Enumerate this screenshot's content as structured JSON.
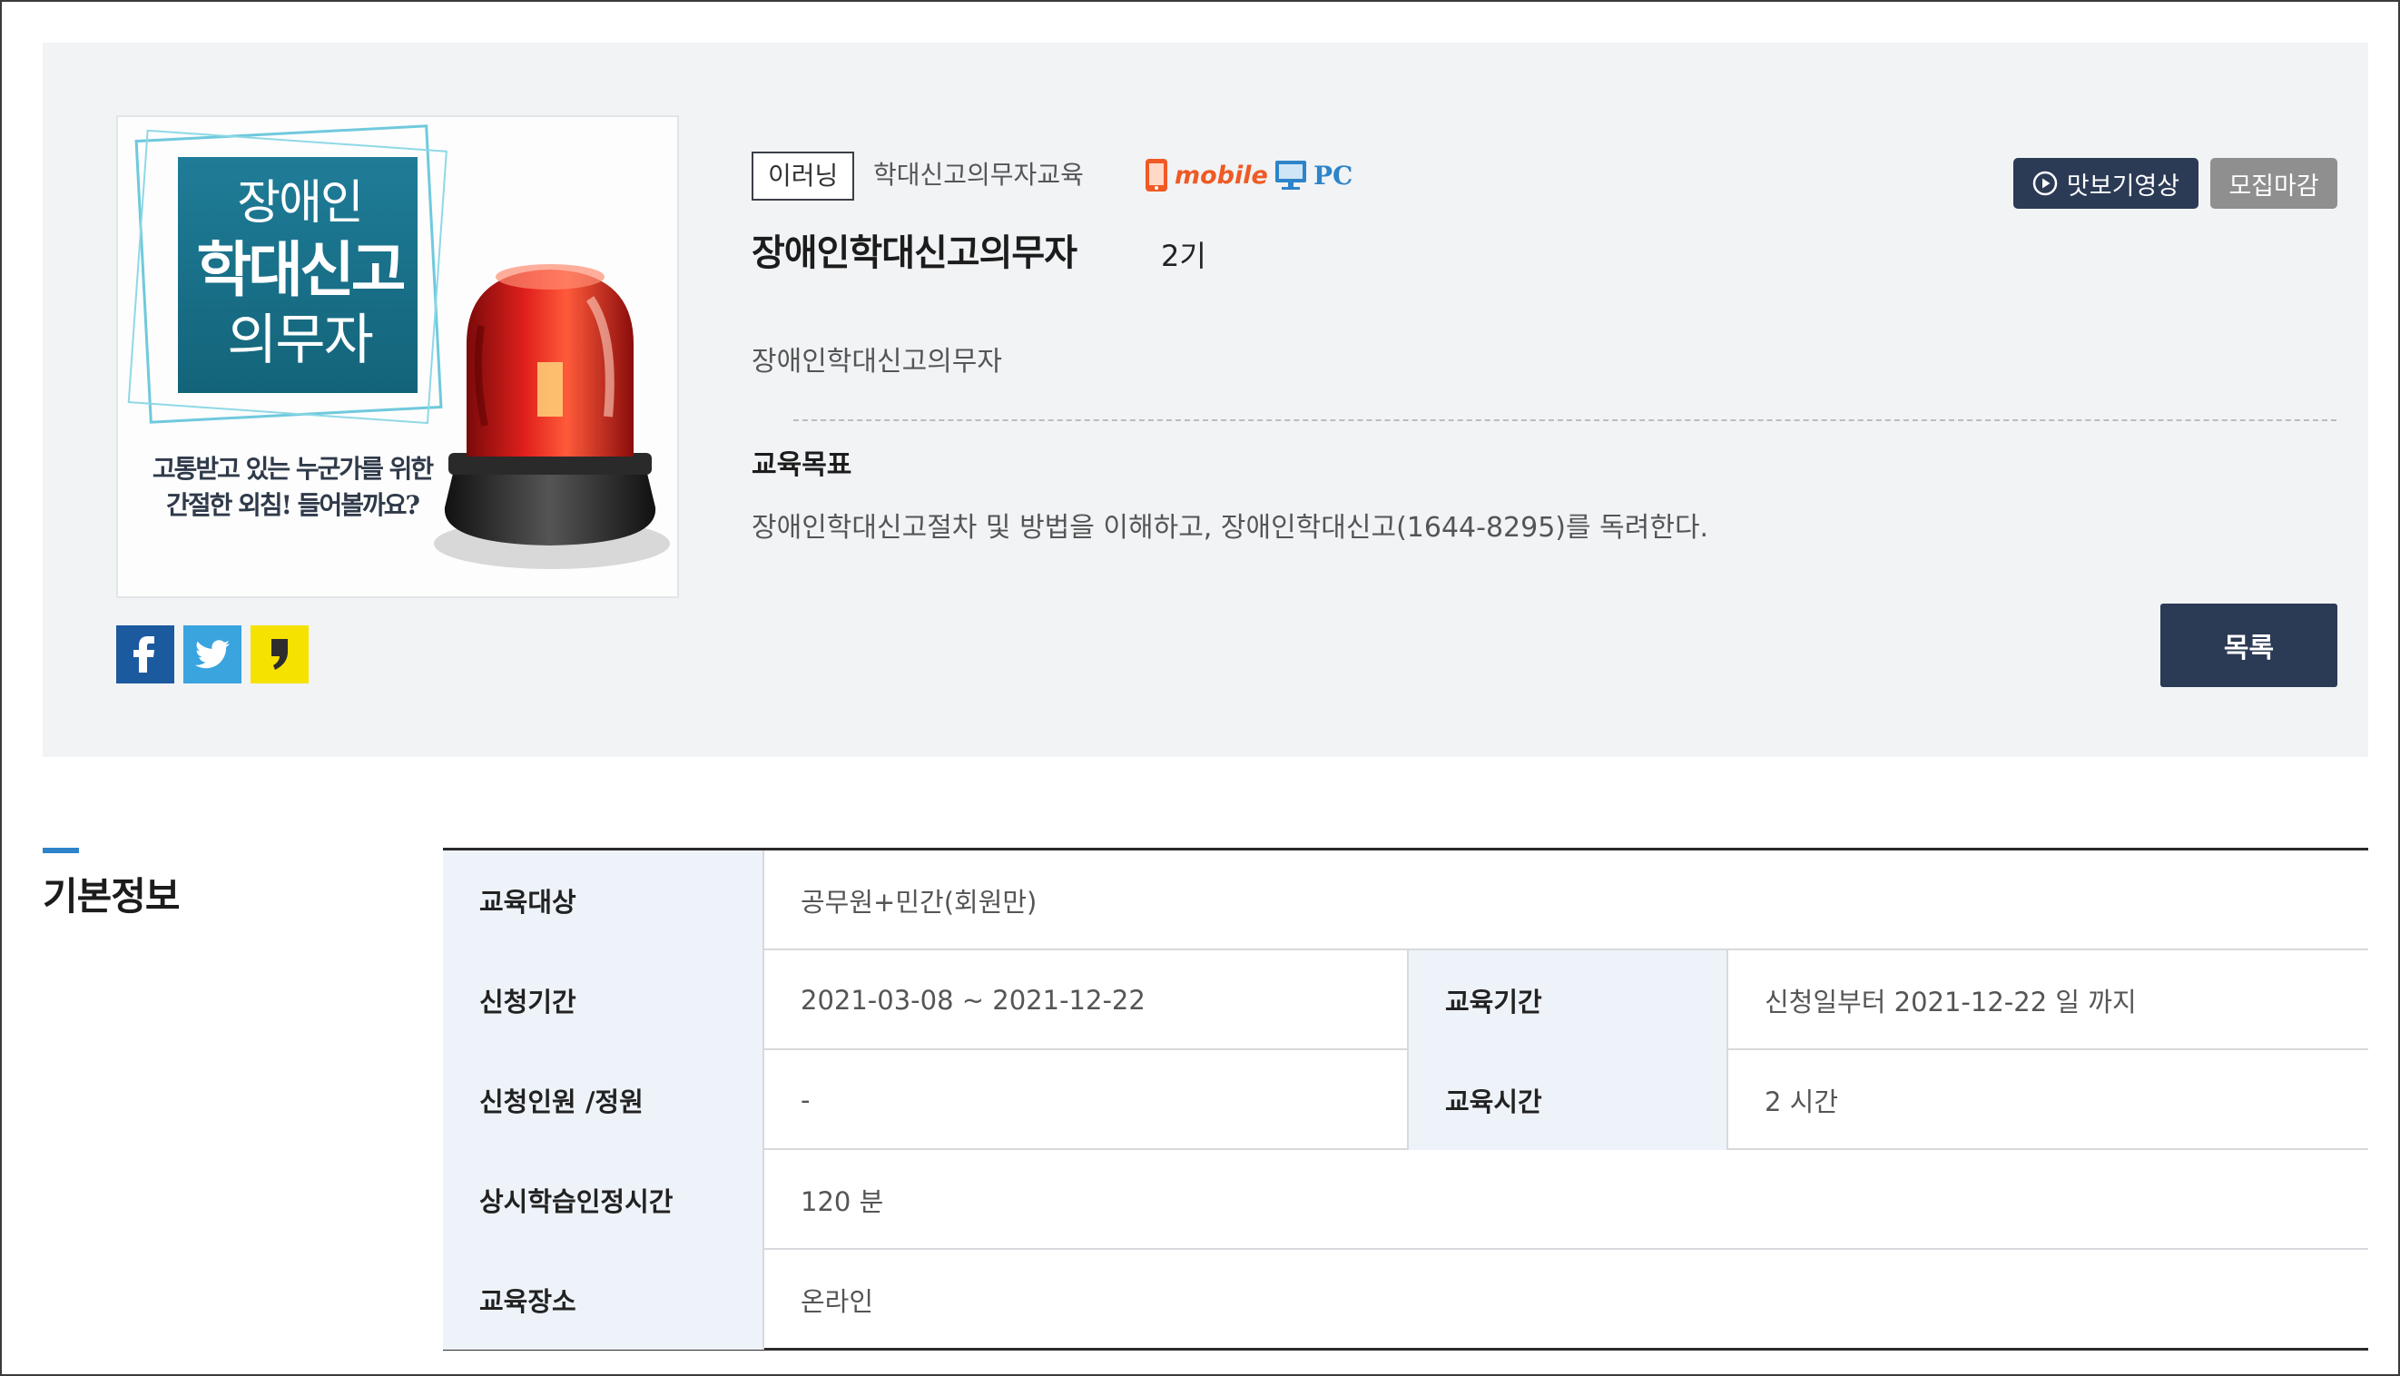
{
  "thumbnail": {
    "title_line1": "장애인",
    "title_line2": "학대신고",
    "title_line3": "의무자",
    "caption_line1": "고통받고 있는 누군가를 위한",
    "caption_line2": "간절한 외침! 들어볼까요?"
  },
  "share": {
    "facebook_icon": "facebook-icon",
    "twitter_icon": "twitter-icon",
    "kakaostory_icon": "kakaostory-icon"
  },
  "course": {
    "type_tag": "이러닝",
    "category": "학대신고의무자교육",
    "device_mobile": "mobile",
    "device_pc": "PC",
    "title": "장애인학대신고의무자",
    "term": "2기",
    "subtitle": "장애인학대신고의무자",
    "goal_heading": "교육목표",
    "goal_text": "장애인학대신고절차 및 방법을 이해하고, 장애인학대신고(1644-8295)를 독려한다."
  },
  "buttons": {
    "preview": "맛보기영상",
    "closed": "모집마감",
    "list": "목록"
  },
  "basic_info": {
    "section_title": "기본정보",
    "rows": [
      {
        "label": "교육대상",
        "value": "공무원+민간(회원만)"
      },
      {
        "label": "신청기간",
        "value": "2021-03-08 ~ 2021-12-22",
        "label2": "교육기간",
        "value2": "신청일부터 2021-12-22 일 까지"
      },
      {
        "label": "신청인원 /정원",
        "value": "-",
        "label2": "교육시간",
        "value2": "2 시간"
      },
      {
        "label": "상시학습인정시간",
        "value": "120 분"
      },
      {
        "label": "교육장소",
        "value": "온라인"
      }
    ]
  },
  "colors": {
    "panel_bg": "#f1f3f5",
    "navy_button": "#2b3a55",
    "closed_button": "#8f8f8f",
    "mobile_orange": "#ef5a24",
    "pc_blue": "#2e84c9",
    "section_accent": "#2e84c9",
    "table_header_bg": "#eef3f9"
  }
}
